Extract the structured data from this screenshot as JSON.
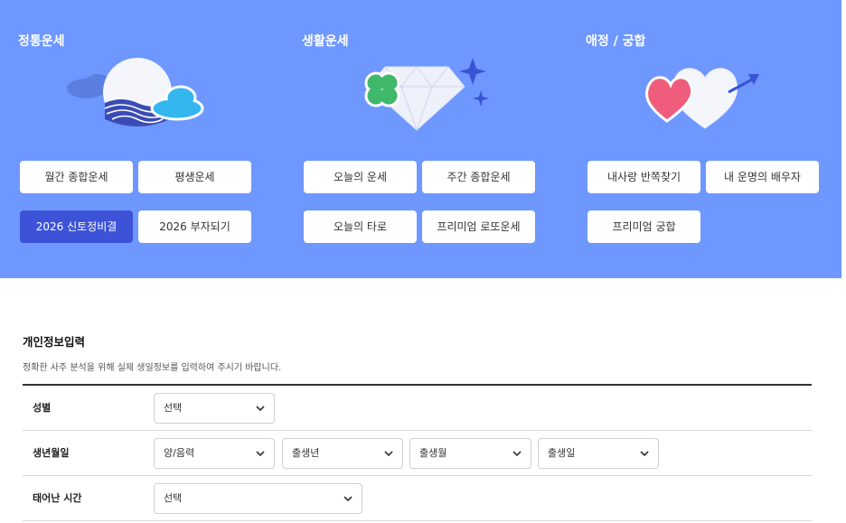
{
  "categories": [
    {
      "title": "정통운세",
      "buttons": [
        "월간 종합운세",
        "평생운세",
        "2026 신토정비결",
        "2026 부자되기"
      ]
    },
    {
      "title": "생활운세",
      "buttons": [
        "오늘의 운세",
        "주간 종합운세",
        "오늘의 타로",
        "프리미엄 로또운세"
      ]
    },
    {
      "title": "애정 / 궁합",
      "buttons": [
        "내사랑 반쪽찾기",
        "내 운명의 배우자",
        "프리미엄 궁합"
      ]
    }
  ],
  "active_button_color": "#3c53d8",
  "banner_color": "#6e97ff",
  "form": {
    "title": "개인정보입력",
    "description": "정확한 사주 분석을 위해 실제 생일정보를 입력하여 주시기 바랍니다.",
    "rows": [
      {
        "label": "성별",
        "selects": [
          "선택"
        ]
      },
      {
        "label": "생년월일",
        "selects": [
          "양/음력",
          "출생년",
          "출생월",
          "출생일"
        ]
      },
      {
        "label": "태어난 시간",
        "selects": [
          "선택"
        ]
      }
    ]
  }
}
